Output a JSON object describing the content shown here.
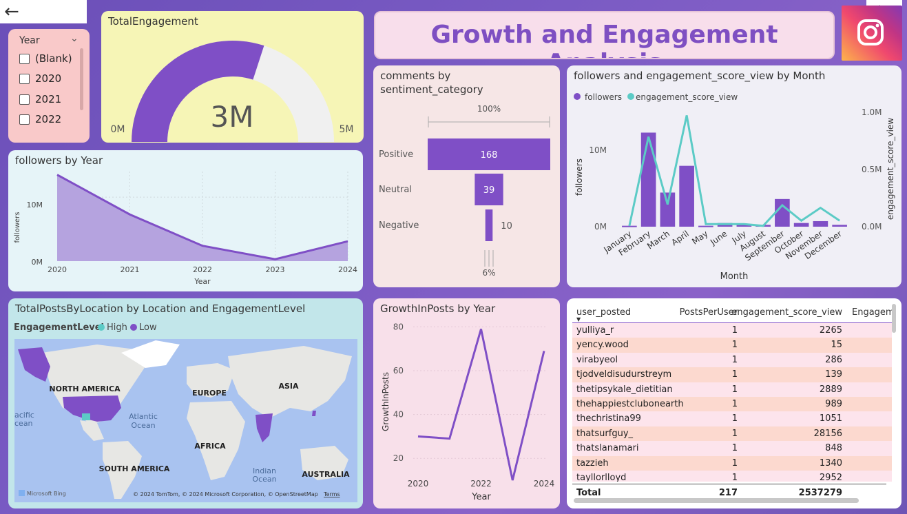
{
  "nav": {
    "back_icon": "arrow-left-icon",
    "forward_icon": "arrow-right-icon"
  },
  "slicer": {
    "header": "Year",
    "items": [
      "(Blank)",
      "2020",
      "2021",
      "2022"
    ]
  },
  "gauge": {
    "title": "TotalEngagement",
    "value_label": "3M",
    "min_label": "0M",
    "max_label": "5M",
    "value": 3000000,
    "min": 0,
    "max": 5000000
  },
  "header": {
    "title": "Growth and Engagement Analysis",
    "logo_icon": "instagram-icon"
  },
  "followers_by_year": {
    "title": "followers by Year",
    "chart_data": {
      "type": "area",
      "x": [
        "2020",
        "2021",
        "2022",
        "2023",
        "2024"
      ],
      "series": [
        {
          "values": [
            13500000,
            7300000,
            2400000,
            300000,
            3100000
          ]
        }
      ],
      "xlabel": "Year",
      "ylabel": "followers",
      "y_ticks": [
        "0M",
        "10M"
      ],
      "ylim": [
        0,
        14000000
      ]
    }
  },
  "comments": {
    "title_line1": "comments by",
    "title_line2": "sentiment_category",
    "top_label": "100%",
    "bottom_label": "6%",
    "chart_data": {
      "type": "bar",
      "categories": [
        "Positive",
        "Neutral",
        "Negative"
      ],
      "values": [
        168,
        39,
        10
      ]
    }
  },
  "followers_engagement": {
    "title": "followers and engagement_score_view by Month",
    "legend": [
      "followers",
      "engagement_score_view"
    ],
    "colors": {
      "followers": "#7f4fc6",
      "engagement": "#5ccbc6"
    },
    "chart_data": {
      "type": "bar",
      "categories": [
        "January",
        "February",
        "March",
        "April",
        "May",
        "June",
        "July",
        "August",
        "September",
        "October",
        "November",
        "December"
      ],
      "series": [
        {
          "name": "followers",
          "values": [
            100000,
            10200000,
            3700000,
            6600000,
            100000,
            400000,
            200000,
            200000,
            3000000,
            400000,
            600000,
            200000
          ]
        },
        {
          "name": "engagement_score_view",
          "values": [
            0.01,
            1.05,
            0.26,
            1.3,
            0.03,
            0.03,
            0.03,
            0.01,
            0.25,
            0.07,
            0.22,
            0.07
          ]
        }
      ],
      "xlabel": "Month",
      "ylabel": "followers",
      "y2label": "engagement_score_view",
      "y_ticks": [
        "0M",
        "10M"
      ],
      "y2_ticks": [
        "0.0M",
        "0.5M",
        "1.0M"
      ],
      "ylim": [
        0,
        13000000
      ],
      "y2lim": [
        0,
        1.4
      ]
    }
  },
  "map": {
    "title": "TotalPostsByLocation by Location and EngagementLevel",
    "legend_title": "EngagementLevel",
    "legend": [
      "High",
      "Low"
    ],
    "labels": [
      "NORTH AMERICA",
      "EUROPE",
      "ASIA",
      "AFRICA",
      "SOUTH AMERICA",
      "AUSTRALIA",
      "Atlantic",
      "Ocean",
      "Indian",
      "Ocean",
      "acific",
      "cean"
    ],
    "bing": "Microsoft Bing",
    "credits": "© 2024 TomTom, © 2024 Microsoft Corporation, © OpenStreetMap",
    "terms": "Terms"
  },
  "growth": {
    "title": "GrowthInPosts by Year",
    "chart_data": {
      "type": "line",
      "x": [
        "2020",
        "2021",
        "2022",
        "2023",
        "2024"
      ],
      "series": [
        {
          "values": [
            30,
            29,
            79,
            10,
            69
          ]
        }
      ],
      "xlabel": "Year",
      "ylabel": "GrowthInPosts",
      "y_ticks": [
        "20",
        "40",
        "60",
        "80"
      ],
      "ylim": [
        10,
        82
      ]
    }
  },
  "table": {
    "headers": [
      "user_posted",
      "PostsPerUser",
      "engagement_score_view",
      "Engagem"
    ],
    "rows": [
      [
        "yulliya_r",
        "1",
        "2265"
      ],
      [
        "yency.wood",
        "1",
        "15"
      ],
      [
        "virabyeol",
        "1",
        "286"
      ],
      [
        "tjodveldisudurstreym",
        "1",
        "139"
      ],
      [
        "thetipsykale_dietitian",
        "1",
        "2889"
      ],
      [
        "thehappiestclubonearth",
        "1",
        "989"
      ],
      [
        "thechristina99",
        "1",
        "1051"
      ],
      [
        "thatsurfguy_",
        "1",
        "28156"
      ],
      [
        "thatslanamari",
        "1",
        "848"
      ],
      [
        "tazzieh",
        "1",
        "1340"
      ],
      [
        "tayllorlloyd",
        "1",
        "2952"
      ]
    ],
    "total": [
      "Total",
      "217",
      "2537279"
    ]
  }
}
